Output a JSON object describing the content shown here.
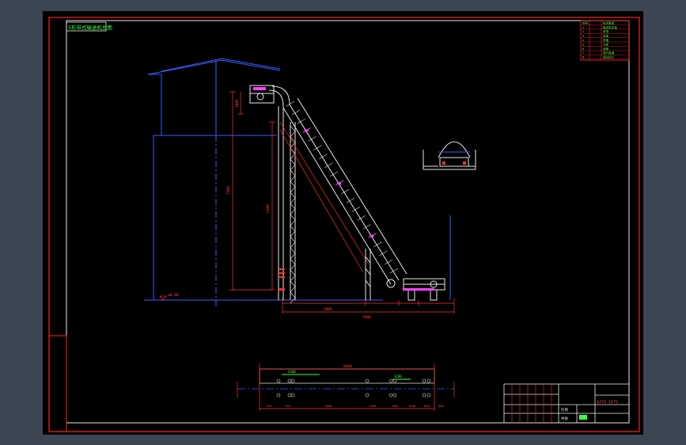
{
  "drawing": {
    "title_label": "S形带式输送机总图",
    "revision_rows": [
      {
        "a": "序号",
        "b": "技术要求"
      },
      {
        "a": "1",
        "b": "输送机安装"
      },
      {
        "a": "2",
        "b": "带宽"
      },
      {
        "a": "3",
        "b": "运量"
      },
      {
        "a": "4",
        "b": "带速"
      },
      {
        "a": "5",
        "b": "功率"
      },
      {
        "a": "6",
        "b": "倾角"
      },
      {
        "a": "7",
        "b": "提升高度"
      },
      {
        "a": "8",
        "b": "调试运行"
      }
    ],
    "title_block": {
      "drawing_no": "1272-1172",
      "scale_label": "比例",
      "sheet_label": "共张"
    },
    "dimensions": {
      "height_main": "7500",
      "height_frame": "5200",
      "head_height": "1000",
      "base_width": "2000",
      "total_length": "5900",
      "plan_total": "8600",
      "plan_top": "4200",
      "plan_top2": "3200",
      "plan_seg1": "750",
      "plan_seg2": "750",
      "plan_seg3": "1800",
      "plan_seg4": "1900",
      "plan_seg5": "800",
      "plan_seg6": "1300",
      "plan_seg7": "800",
      "plan_seg8": "500",
      "ground_mark": "±0.00"
    }
  }
}
